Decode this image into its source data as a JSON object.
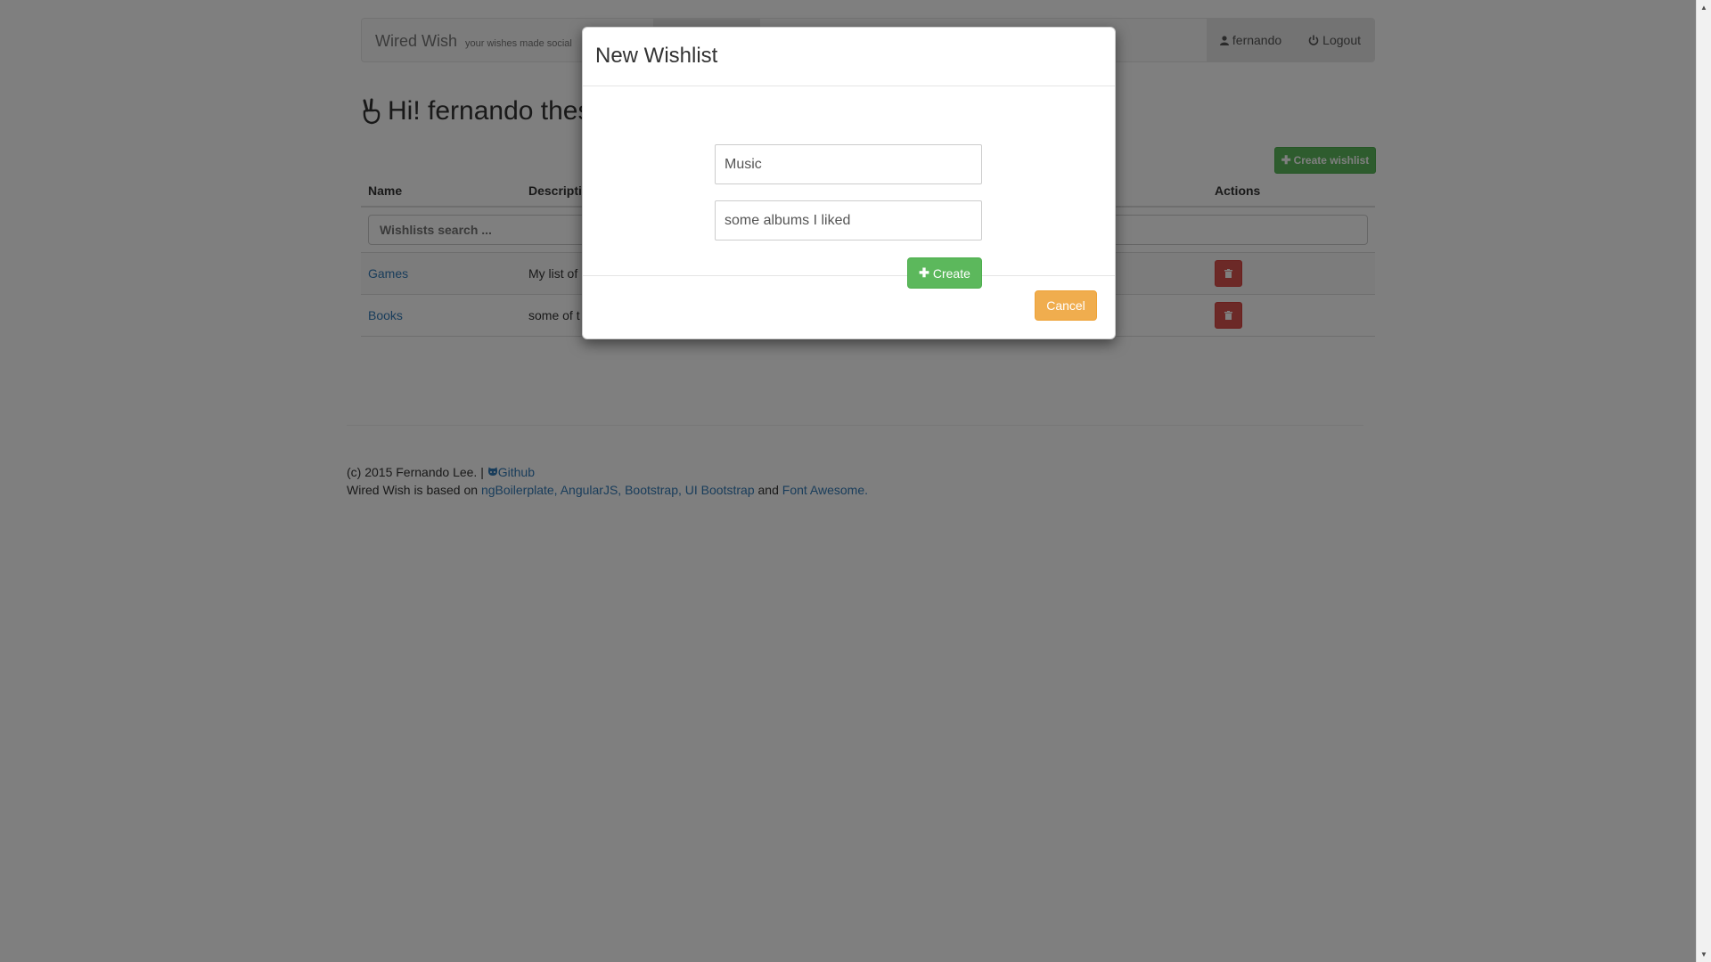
{
  "navbar": {
    "brand": "Wired Wish",
    "tagline": "your wishes made social",
    "user": "fernando",
    "logout": "Logout"
  },
  "page": {
    "greeting": "Hi! fernando thes",
    "create_wishlist_label": "Create wishlist"
  },
  "table": {
    "headers": {
      "name": "Name",
      "description": "Descripti",
      "actions": "Actions"
    },
    "search_placeholder": "Wishlists search ...",
    "rows": [
      {
        "name": "Games",
        "description": "My list of"
      },
      {
        "name": "Books",
        "description": "some of t"
      }
    ]
  },
  "footer": {
    "copyright": "(c) 2015 Fernando Lee. |",
    "github": "Github",
    "based_on": "Wired Wish is based on",
    "links": [
      "ngBoilerplate,",
      "AngularJS,",
      "Bootstrap,",
      "UI Bootstrap"
    ],
    "and": "and",
    "font_awesome": "Font Awesome."
  },
  "modal": {
    "title": "New Wishlist",
    "name_value": "Music",
    "description_value": "some albums I liked",
    "create_label": "Create",
    "cancel_label": "Cancel"
  },
  "colors": {
    "success": "#5cb85c",
    "danger": "#d9534f",
    "warning": "#f0ad4e",
    "link": "#337ab7"
  },
  "icons": [
    "user-icon",
    "power-icon",
    "victory-hand-icon",
    "plus-icon",
    "trash-icon",
    "github-icon"
  ]
}
